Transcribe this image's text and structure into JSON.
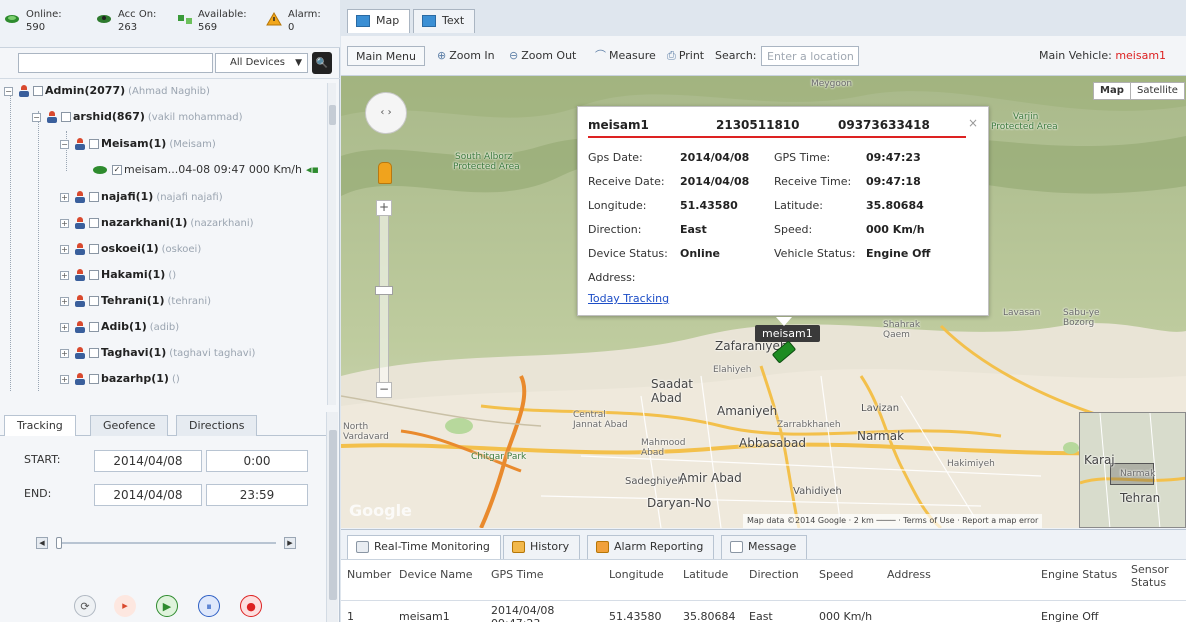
{
  "stats": [
    {
      "label": "Online:",
      "value": "590"
    },
    {
      "label": "Acc On:",
      "value": "263"
    },
    {
      "label": "Available:",
      "value": "569"
    },
    {
      "label": "Alarm:",
      "value": "0"
    }
  ],
  "search": {
    "filter": "All Devices",
    "filter_arrow": "▼",
    "button_icon": "🔍"
  },
  "tree": [
    {
      "name": "Admin(2077)",
      "sub": "(Ahmad Naghib)"
    },
    {
      "name": "arshid(867)",
      "sub": "(vakil mohammad)"
    },
    {
      "name": "Meisam(1)",
      "sub": "(Meisam)"
    },
    {
      "device": "meisam...04-08 09:47 000 Km/h"
    },
    {
      "name": "najafi(1)",
      "sub": "(najafi najafi)"
    },
    {
      "name": "nazarkhani(1)",
      "sub": "(nazarkhani)"
    },
    {
      "name": "oskoei(1)",
      "sub": "(oskoei)"
    },
    {
      "name": "Hakami(1)",
      "sub": "()"
    },
    {
      "name": "Tehrani(1)",
      "sub": "(tehrani)"
    },
    {
      "name": "Adib(1)",
      "sub": "(adib)"
    },
    {
      "name": "Taghavi(1)",
      "sub": "(taghavi taghavi)"
    },
    {
      "name": "bazarhp(1)",
      "sub": "()"
    }
  ],
  "left_tabs": [
    "Tracking",
    "Geofence",
    "Directions"
  ],
  "tracking": {
    "start_label": "START:",
    "start_date": "2014/04/08",
    "start_time": "0:00",
    "end_label": "END:",
    "end_date": "2014/04/08",
    "end_time": "23:59"
  },
  "playback": [
    "⟳",
    "▸",
    "▶",
    "⏸",
    "●"
  ],
  "main_tabs": [
    "Map",
    "Text"
  ],
  "toolbar": {
    "main_menu": "Main Menu",
    "zoom_in": "Zoom In",
    "zoom_out": "Zoom Out",
    "measure": "Measure",
    "print": "Print",
    "search_label": "Search:",
    "search_placeholder": "Enter a location",
    "main_vehicle_label": "Main Vehicle:",
    "main_vehicle_value": "meisam1"
  },
  "map": {
    "types": [
      "Map",
      "Satellite"
    ],
    "vehicle_label": "meisam1",
    "attribution": "Map data ©2014 Google · 2 km ──── · Terms of Use · Report a map error",
    "labels": [
      {
        "text": "Meygoon"
      },
      {
        "text": "South Alborz"
      },
      {
        "text": "Protected Area"
      },
      {
        "text": "Varjin"
      },
      {
        "text": "Protected Area"
      },
      {
        "text": "Lavasan"
      },
      {
        "text": "Sabu-ye Bozorg"
      },
      {
        "text": "Zafaraniyeh"
      },
      {
        "text": "Shahrak Qaem"
      },
      {
        "text": "Elahiyeh"
      },
      {
        "text": "Saadat Abad"
      },
      {
        "text": "Amaniyeh"
      },
      {
        "text": "Zarrabkhaneh"
      },
      {
        "text": "Lavizan"
      },
      {
        "text": "Central Jannat Abad"
      },
      {
        "text": "Mahmood Abad"
      },
      {
        "text": "Abbasabad"
      },
      {
        "text": "Narmak"
      },
      {
        "text": "Chitgar Park"
      },
      {
        "text": "Sadeghiyeh"
      },
      {
        "text": "Amir Abad"
      },
      {
        "text": "Hakimiyeh"
      },
      {
        "text": "Daryan-No"
      },
      {
        "text": "Vahidiyeh"
      },
      {
        "text": "North Vardavard"
      },
      {
        "text": "Karaj"
      },
      {
        "text": "Tehran"
      },
      {
        "text": "Narmak"
      }
    ]
  },
  "popup": {
    "device": "meisam1",
    "imei": "2130511810",
    "phone": "09373633418",
    "close": "×",
    "rows": [
      {
        "k1": "Gps Date:",
        "v1": "2014/04/08",
        "k2": "GPS Time:",
        "v2": "09:47:23"
      },
      {
        "k1": "Receive Date:",
        "v1": "2014/04/08",
        "k2": "Receive Time:",
        "v2": "09:47:18"
      },
      {
        "k1": "Longitude:",
        "v1": "51.43580",
        "k2": "Latitude:",
        "v2": "35.80684"
      },
      {
        "k1": "Direction:",
        "v1": "East",
        "k2": "Speed:",
        "v2": "000 Km/h"
      },
      {
        "k1": "Device Status:",
        "v1": "Online",
        "k2": "Vehicle Status:",
        "v2": "Engine Off"
      },
      {
        "k1": "Address:",
        "v1": "",
        "k2": "",
        "v2": ""
      }
    ],
    "link": "Today Tracking"
  },
  "bottom_tabs": [
    "Real-Time Monitoring",
    "History",
    "Alarm Reporting",
    "Message"
  ],
  "grid": {
    "headers": [
      "Number",
      "Device Name",
      "GPS Time",
      "Longitude",
      "Latitude",
      "Direction",
      "Speed",
      "Address",
      "Engine Status",
      "Sensor Status"
    ],
    "row": [
      "1",
      "meisam1",
      "2014/04/08 09:47:23",
      "51.43580",
      "35.80684",
      "East",
      "000 Km/h",
      "",
      "Engine Off",
      ""
    ]
  }
}
